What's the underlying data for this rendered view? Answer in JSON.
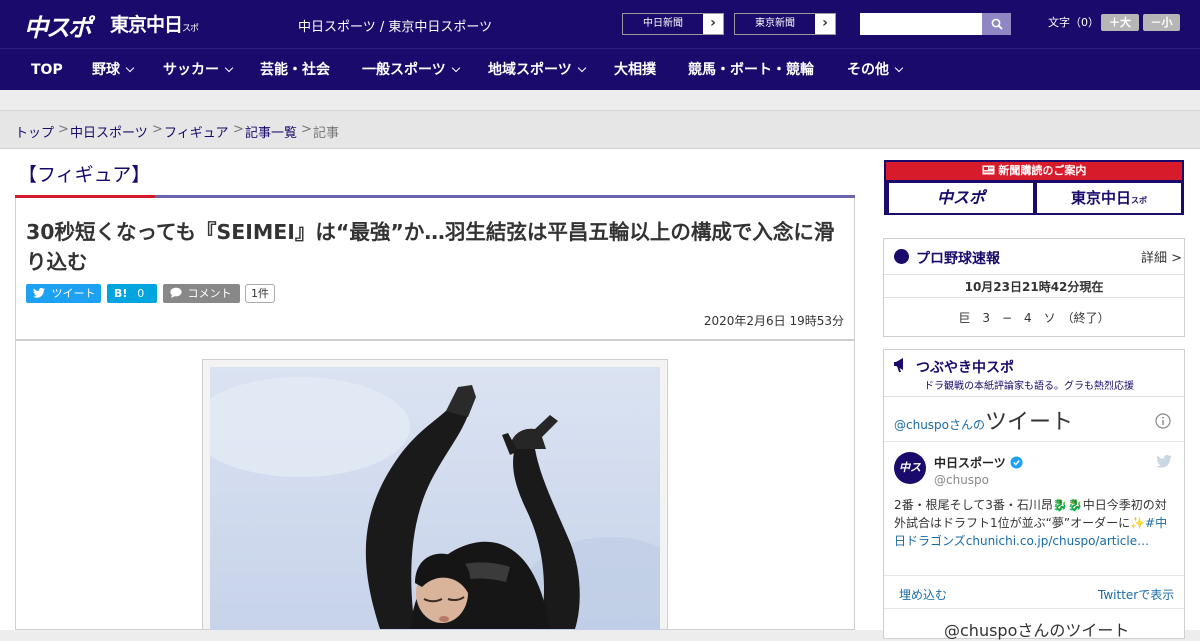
{
  "header": {
    "logo_chuspo": "中スポ",
    "logo_tokyo": "東京中日",
    "logo_tokyo_small": "スポ",
    "site_desc": "中日スポーツ / 東京中日スポーツ",
    "ext_links": [
      "中日新聞",
      "東京新聞"
    ],
    "search_placeholder": "",
    "font_size_label": "文字（0）",
    "font_larger": "＋大",
    "font_smaller": "－小"
  },
  "nav": {
    "items": [
      {
        "label": "TOP",
        "has_menu": false
      },
      {
        "label": "野球",
        "has_menu": true
      },
      {
        "label": "サッカー",
        "has_menu": true
      },
      {
        "label": "芸能・社会",
        "has_menu": false
      },
      {
        "label": "一般スポーツ",
        "has_menu": true
      },
      {
        "label": "地域スポーツ",
        "has_menu": true
      },
      {
        "label": "大相撲",
        "has_menu": false
      },
      {
        "label": "競馬・ボート・競輪",
        "has_menu": false
      },
      {
        "label": "その他",
        "has_menu": true
      }
    ]
  },
  "breadcrumb": {
    "items": [
      "トップ",
      "中日スポーツ",
      "フィギュア",
      "記事一覧"
    ],
    "separator": ">",
    "current": "記事"
  },
  "article": {
    "category": "【フィギュア】",
    "headline": "30秒短くなっても『SEIMEI』は“最強”か…羽生結弦は平昌五輪以上の構成で入念に滑り込む",
    "share_tweet": "ツイート",
    "share_hatena_icon": "B!",
    "share_hatena_count": "0",
    "share_comment": "コメント",
    "comment_count": "1件",
    "published": "2020年2月6日 19時53分"
  },
  "sidebar": {
    "subscribe": {
      "header": "新聞購読のご案内",
      "left": "中スポ",
      "right": "東京中日",
      "right_small": "スポ"
    },
    "baseball": {
      "title": "プロ野球速報",
      "detail": "詳細 >",
      "timestamp": "10月23日21時42分現在",
      "score": "巨　3　−　4　ソ　（終了）"
    },
    "tsubuyaki": {
      "title": "つぶやき中スポ",
      "subtitle": "ドラ観戦の本紙評論家も語る。グラも熱烈応援",
      "tweets_owner": "@chuspoさんの",
      "tweets_label": "ツイート",
      "tweet": {
        "name": "中日スポーツ",
        "handle": "@chuspo",
        "avatar_text": "中スポ",
        "text": "2番・根尾そして3番・石川昂🐉🐉中日今季初の対外試合はドラフト1位が並ぶ“夢”オーダーに✨",
        "hashtag": "#中日ドラゴンズ",
        "link": "chunichi.co.jp/chuspo/article…"
      },
      "embed": "埋め込む",
      "view_on_twitter": "Twitterで表示",
      "more": "@chuspoさんのツイート"
    }
  },
  "colors": {
    "brand_navy": "#1a0a6b",
    "accent_red": "#d81b2b",
    "accent_purple": "#6b63b1",
    "twitter_blue": "#1da1f2",
    "hatena_blue": "#00a4de",
    "comment_gray": "#888888"
  }
}
